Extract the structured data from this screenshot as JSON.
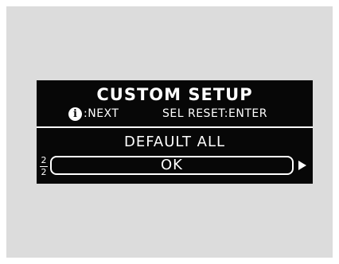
{
  "screen": {
    "title": "CUSTOM SETUP",
    "hints": {
      "info_icon": "i",
      "next_label": ":NEXT",
      "reset_label": "SEL RESET:ENTER"
    },
    "item": {
      "title": "DEFAULT ALL",
      "button_label": "OK"
    },
    "page": {
      "current": "2",
      "total": "2"
    }
  },
  "colors": {
    "panel": "#dcdcdc",
    "screen": "#070707",
    "text": "#ffffff"
  },
  "icons": {
    "info": "info-icon",
    "next": "right-arrow-icon"
  }
}
